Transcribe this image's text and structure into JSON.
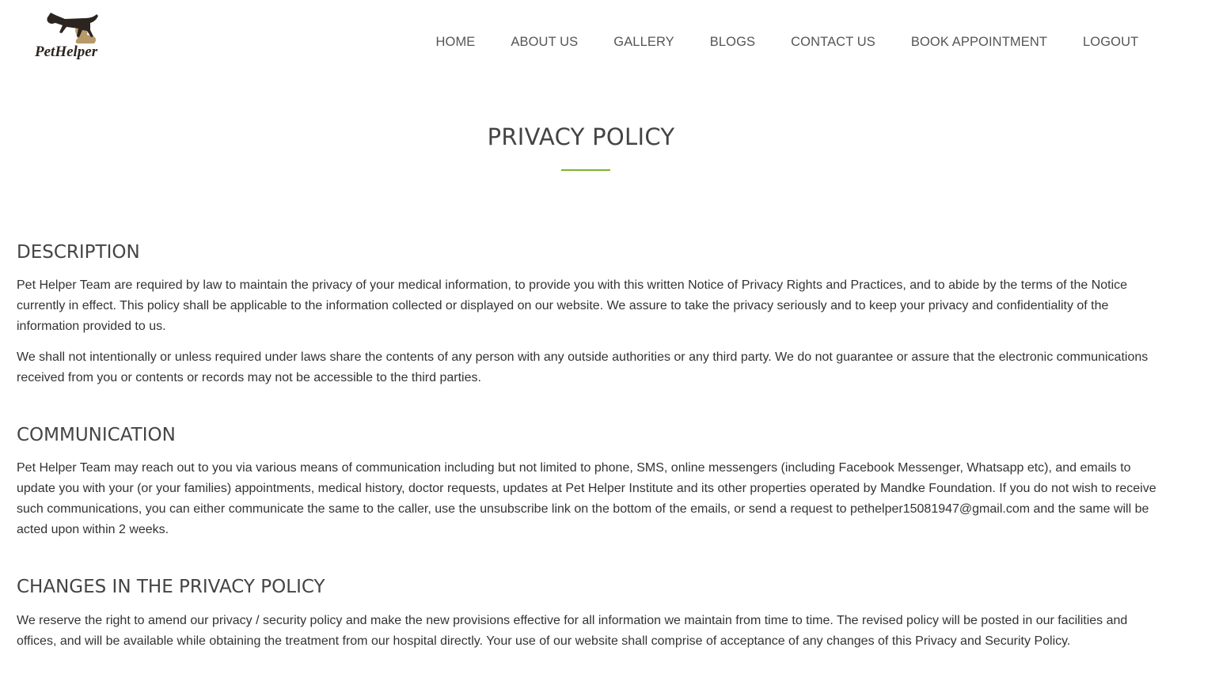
{
  "brand": {
    "logo_text": "PetHelper",
    "logo_icon": "dog-and-cat-logo-icon"
  },
  "nav": {
    "items": [
      {
        "label": "HOME"
      },
      {
        "label": "ABOUT US"
      },
      {
        "label": "GALLERY"
      },
      {
        "label": "BLOGS"
      },
      {
        "label": "CONTACT US"
      },
      {
        "label": "BOOK APPOINTMENT"
      },
      {
        "label": "LOGOUT"
      }
    ]
  },
  "page": {
    "title": "PRIVACY POLICY",
    "accent_color": "#7ab32e"
  },
  "sections": [
    {
      "heading": "DESCRIPTION",
      "paragraphs": [
        "Pet Helper Team are required by law to maintain the privacy of your medical information, to provide you with this written Notice of Privacy Rights and Practices, and to abide by the terms of the Notice currently in effect. This policy shall be applicable to the information collected or displayed on our website. We assure to take the privacy seriously and to keep your privacy and confidentiality of the information provided to us.",
        "We shall not intentionally or unless required under laws share the contents of any person with any outside authorities or any third party. We do not guarantee or assure that the electronic communications received from you or contents or records may not be accessible to the third parties."
      ]
    },
    {
      "heading": "COMMUNICATION",
      "paragraphs": [
        "Pet Helper Team may reach out to you via various means of communication including but not limited to phone, SMS, online messengers (including Facebook Messenger, Whatsapp etc), and emails to update you with your (or your families) appointments, medical history, doctor requests, updates at Pet Helper Institute and its other properties operated by Mandke Foundation. If you do not wish to receive such communications, you can either communicate the same to the caller, use the unsubscribe link on the bottom of the emails, or send a request to pethelper15081947@gmail.com and the same will be acted upon within 2 weeks."
      ]
    },
    {
      "heading": "CHANGES IN THE PRIVACY POLICY",
      "paragraphs": [
        "We reserve the right to amend our privacy / security policy and make the new provisions effective for all information we maintain from time to time. The revised policy will be posted in our facilities and offices, and will be available while obtaining the treatment from our hospital directly. Your use of our website shall comprise of acceptance of any changes of this Privacy and Security Policy."
      ]
    }
  ]
}
